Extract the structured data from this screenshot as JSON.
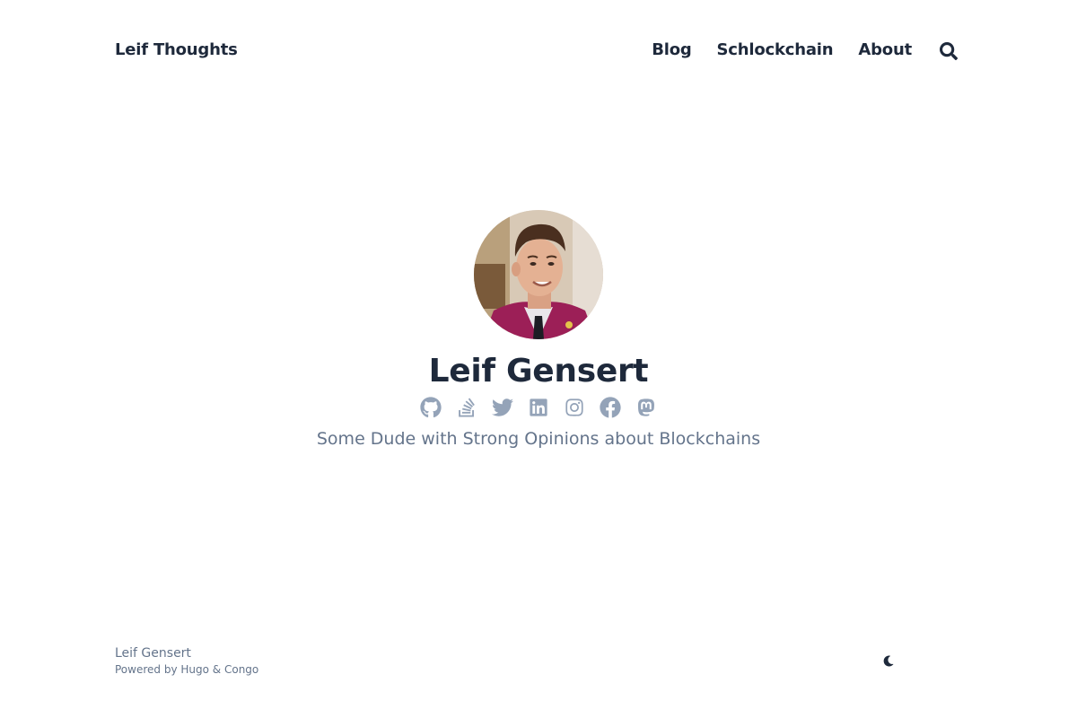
{
  "header": {
    "site_title": "Leif Thoughts",
    "nav": [
      {
        "label": "Blog"
      },
      {
        "label": "Schlockchain"
      },
      {
        "label": "About"
      }
    ],
    "search_icon": "search-icon"
  },
  "hero": {
    "avatar_icon": "author-photo",
    "name": "Leif Gensert",
    "socials": [
      {
        "icon": "github-icon"
      },
      {
        "icon": "stack-overflow-icon"
      },
      {
        "icon": "twitter-icon"
      },
      {
        "icon": "linkedin-icon"
      },
      {
        "icon": "instagram-icon"
      },
      {
        "icon": "facebook-icon"
      },
      {
        "icon": "mastodon-icon"
      }
    ],
    "tagline": "Some Dude with Strong Opinions about Blockchains"
  },
  "footer": {
    "copyright": "Leif Gensert",
    "powered_prefix": "Powered by ",
    "hugo_label": "Hugo",
    "amp": " & ",
    "congo_label": "Congo",
    "theme_toggle_icon": "moon-icon"
  },
  "colors": {
    "text_primary": "#1e293b",
    "text_muted": "#64748b",
    "icon_muted": "#94a3b8",
    "background": "#ffffff"
  }
}
